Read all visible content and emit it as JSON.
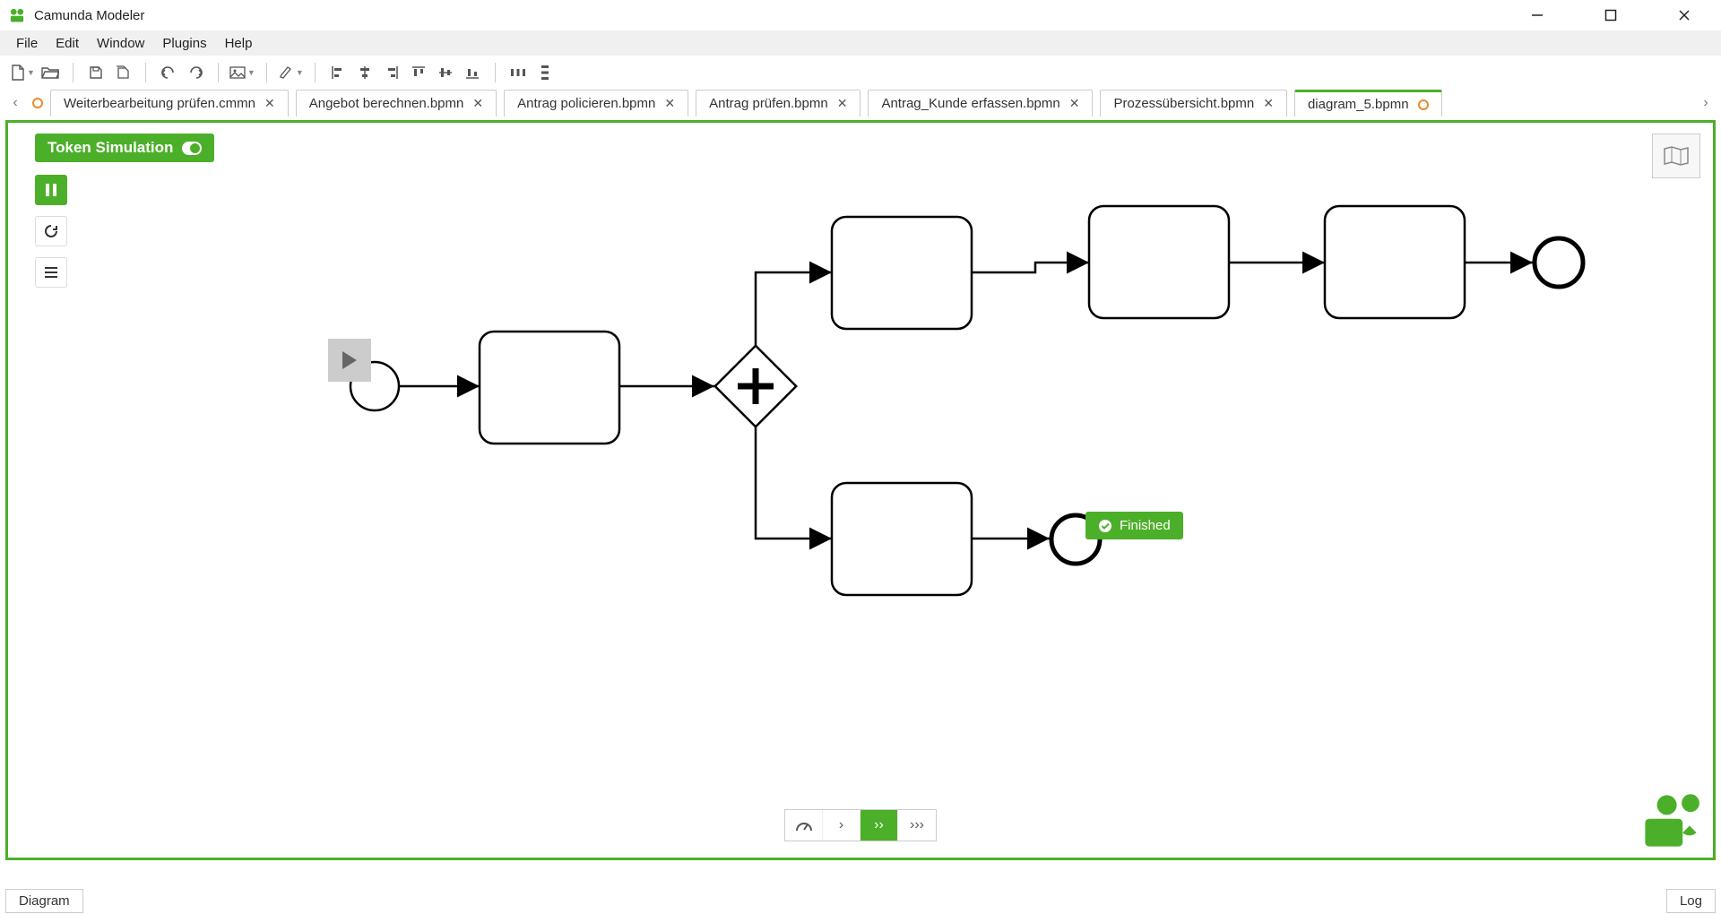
{
  "app": {
    "title": "Camunda Modeler"
  },
  "menu": {
    "items": [
      "File",
      "Edit",
      "Window",
      "Plugins",
      "Help"
    ]
  },
  "toolbar": {
    "groups": [
      [
        "new-file",
        "open-file"
      ],
      [
        "save",
        "save-all"
      ],
      [
        "undo",
        "redo"
      ],
      [
        "image-export"
      ],
      [
        "highlight"
      ],
      [
        "align-left",
        "align-center-h",
        "align-right",
        "align-top",
        "align-center-v",
        "align-bottom"
      ],
      [
        "distribute-h",
        "distribute-v"
      ]
    ]
  },
  "tabs": {
    "scroll_left": "‹",
    "scroll_right": "›",
    "dirty_indicator": true,
    "items": [
      {
        "label": "Weiterbearbeitung prüfen.cmmn",
        "active": false,
        "closeable": true
      },
      {
        "label": "Angebot berechnen.bpmn",
        "active": false,
        "closeable": true
      },
      {
        "label": "Antrag policieren.bpmn",
        "active": false,
        "closeable": true
      },
      {
        "label": "Antrag prüfen.bpmn",
        "active": false,
        "closeable": true
      },
      {
        "label": "Antrag_Kunde erfassen.bpmn",
        "active": false,
        "closeable": true
      },
      {
        "label": "Prozessübersicht.bpmn",
        "active": false,
        "closeable": true
      },
      {
        "label": "diagram_5.bpmn",
        "active": true,
        "closeable": false,
        "dirty": true
      }
    ]
  },
  "simulation": {
    "badge_label": "Token Simulation",
    "tools": {
      "pause": "pause",
      "reset": "reset",
      "log": "log"
    },
    "speed": {
      "options": [
        "gauge",
        "slow",
        "medium",
        "fast"
      ],
      "active_index": 2
    },
    "finished_label": "Finished"
  },
  "footer": {
    "left_tab": "Diagram",
    "right_tab": "Log"
  },
  "colors": {
    "accent": "#4caf29",
    "dirty": "#e98b2e"
  }
}
